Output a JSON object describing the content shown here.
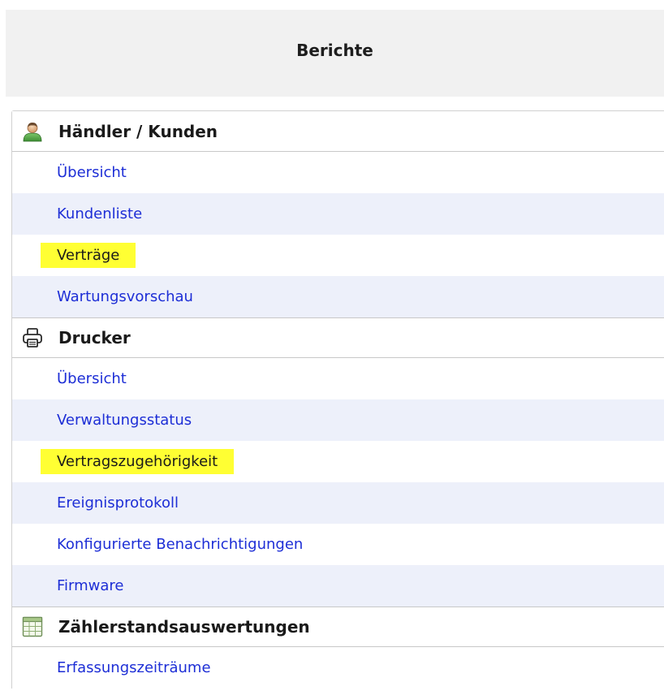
{
  "header": {
    "title": "Berichte"
  },
  "sections": [
    {
      "title": "Händler / Kunden",
      "icon": "user-icon",
      "items": [
        {
          "label": "Übersicht",
          "highlighted": false
        },
        {
          "label": "Kundenliste",
          "highlighted": false
        },
        {
          "label": "Verträge",
          "highlighted": true
        },
        {
          "label": "Wartungsvorschau",
          "highlighted": false
        }
      ]
    },
    {
      "title": "Drucker",
      "icon": "printer-icon",
      "items": [
        {
          "label": "Übersicht",
          "highlighted": false
        },
        {
          "label": "Verwaltungsstatus",
          "highlighted": false
        },
        {
          "label": "Vertragszugehörigkeit",
          "highlighted": true
        },
        {
          "label": "Ereignisprotokoll",
          "highlighted": false
        },
        {
          "label": "Konfigurierte Benachrichtigungen",
          "highlighted": false
        },
        {
          "label": "Firmware",
          "highlighted": false
        }
      ]
    },
    {
      "title": "Zählerstandsauswertungen",
      "icon": "spreadsheet-icon",
      "items": [
        {
          "label": "Erfassungszeiträume",
          "highlighted": false
        }
      ]
    }
  ],
  "colors": {
    "link": "#1d2ed6",
    "highlight": "#ffff33",
    "row_shade": "#edf0fa",
    "header_bg": "#f1f1f1"
  }
}
